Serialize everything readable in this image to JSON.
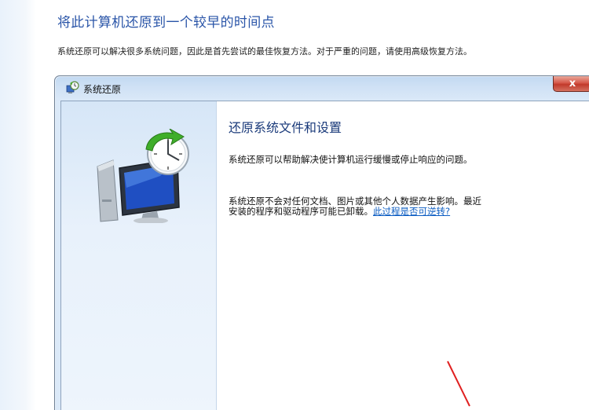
{
  "page": {
    "heading": "将此计算机还原到一个较早的时间点",
    "description": "系统还原可以解决很多系统问题，因此是首先尝试的最佳恢复方法。对于严重的问题，请使用高级恢复方法。"
  },
  "dialog": {
    "title": "系统还原",
    "close_label": "x",
    "content": {
      "heading": "还原系统文件和设置",
      "paragraph1": "系统还原可以帮助解决使计算机运行缓慢或停止响应的问题。",
      "paragraph2_line1": "系统还原不会对任何文档、图片或其他个人数据产生影响。最近",
      "paragraph2_line2": "安装的程序和驱动程序可能已卸载。",
      "link": "此过程是否可逆转?"
    }
  },
  "colors": {
    "heading_blue": "#2a55a8",
    "link_blue": "#0b5cc2",
    "close_red": "#c13a2b",
    "annotation_arrow": "#e02020"
  },
  "icons": [
    "system-restore-icon",
    "computer-restore-icon",
    "close-icon"
  ]
}
